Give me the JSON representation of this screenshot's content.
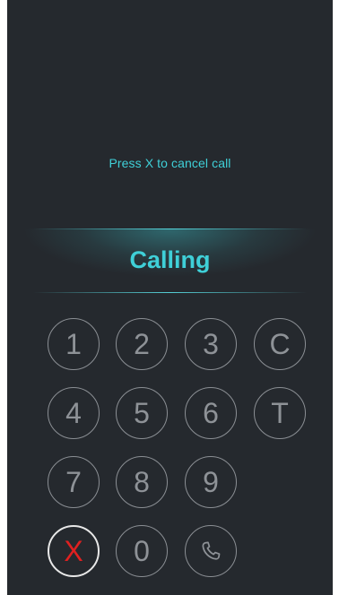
{
  "hint": "Press X to cancel call",
  "status": "Calling",
  "keypad": {
    "rows": [
      [
        "1",
        "2",
        "3",
        "C"
      ],
      [
        "4",
        "5",
        "6",
        "T"
      ],
      [
        "7",
        "8",
        "9"
      ],
      [
        "X",
        "0"
      ]
    ],
    "call_icon": "phone-icon"
  },
  "colors": {
    "background": "#25292e",
    "accent": "#3fd0d8",
    "key_text": "#8e9297",
    "cancel": "#e02020"
  }
}
